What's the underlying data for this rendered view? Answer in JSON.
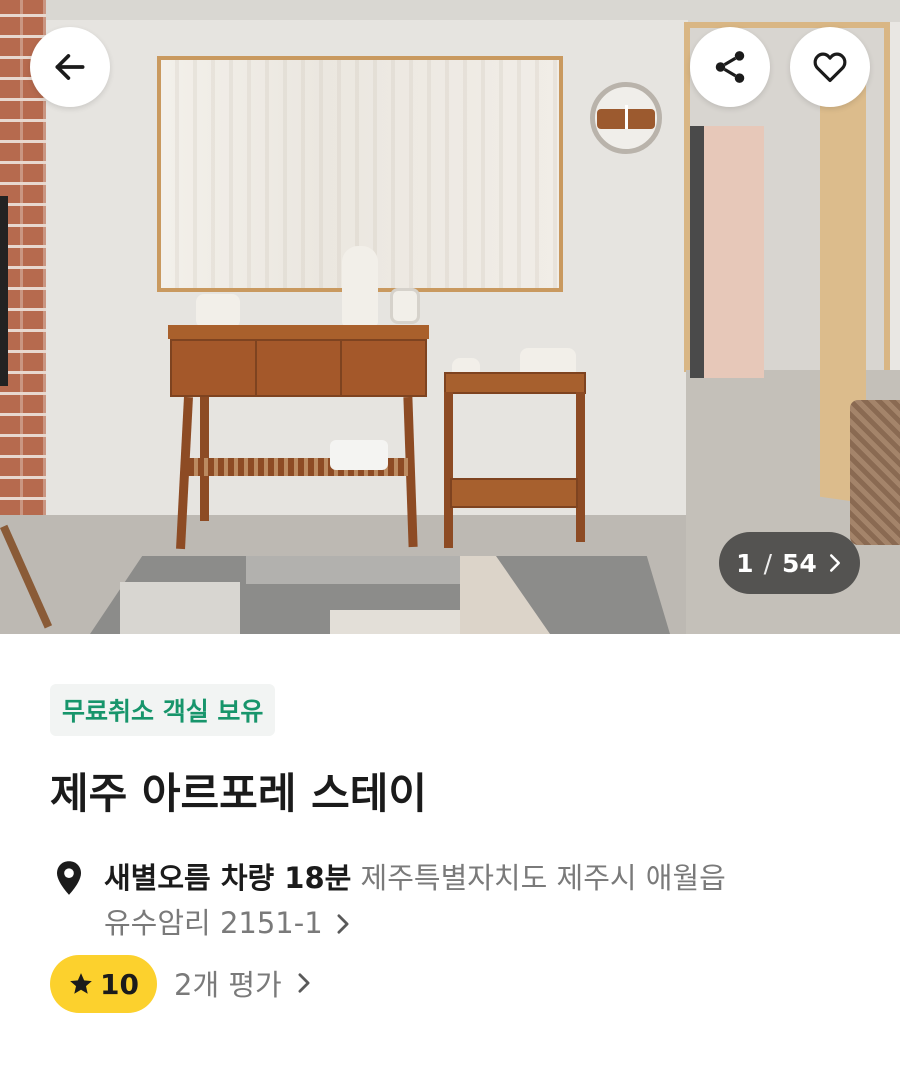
{
  "gallery": {
    "current": "1",
    "separator": "/",
    "total": "54",
    "photo_alt": "room-photo"
  },
  "actions": {
    "back_icon": "arrow-left-icon",
    "share_icon": "share-icon",
    "wishlist_icon": "heart-icon"
  },
  "listing": {
    "badge": "무료취소 객실 보유",
    "name": "제주 아르포레 스테이",
    "location_highlight": "새별오름 차량 18분",
    "address_line1": "제주특별자치도 제주시 애월읍",
    "address_line2": "유수암리 2151-1",
    "rating": "10",
    "review_count": "2개 평가"
  },
  "colors": {
    "badge_text": "#17956b",
    "badge_bg": "#f2f4f3",
    "rating_bg": "#fcd12d",
    "secondary_text": "#7a7a7a"
  }
}
